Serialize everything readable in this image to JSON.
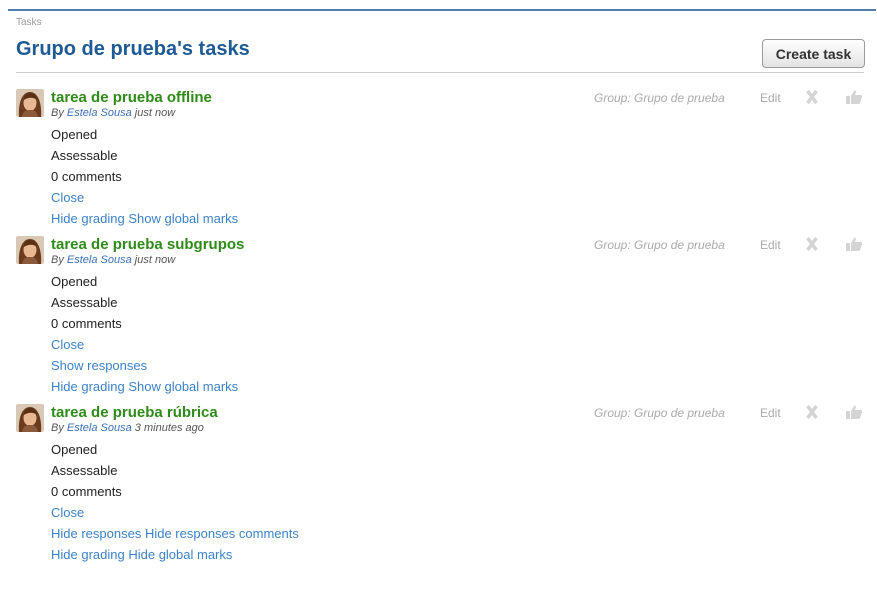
{
  "breadcrumb": "Tasks",
  "page_title": "Grupo de prueba's tasks",
  "create_button": "Create task",
  "tasks": [
    {
      "title": "tarea de prueba offline",
      "by": "By",
      "author": "Estela Sousa",
      "time": "just now",
      "group": "Group: Grupo de prueba",
      "edit": "Edit",
      "status": "Opened",
      "assessable": "Assessable",
      "comments": "0 comments",
      "close": "Close",
      "grading": "Hide grading",
      "marks": "Show global marks"
    },
    {
      "title": "tarea de prueba subgrupos",
      "by": "By",
      "author": "Estela Sousa",
      "time": "just now",
      "group": "Group: Grupo de prueba",
      "edit": "Edit",
      "status": "Opened",
      "assessable": "Assessable",
      "comments": "0 comments",
      "close": "Close",
      "responses": "Show responses",
      "grading": "Hide grading",
      "marks": "Show global marks"
    },
    {
      "title": "tarea de prueba rúbrica",
      "by": "By",
      "author": "Estela Sousa",
      "time": "3 minutes ago",
      "group": "Group: Grupo de prueba",
      "edit": "Edit",
      "status": "Opened",
      "assessable": "Assessable",
      "comments": "0 comments",
      "close": "Close",
      "responses": "Hide responses",
      "responses_comments": "Hide responses comments",
      "grading": "Hide grading",
      "marks": "Hide global marks"
    }
  ],
  "icons": {
    "avatar": "user-avatar",
    "delete": "delete-icon",
    "like": "like-icon"
  },
  "colors": {
    "title": "#1d5a96",
    "task_title": "#2e8b18",
    "link": "#3b82c8",
    "muted": "#aaaaaa"
  }
}
